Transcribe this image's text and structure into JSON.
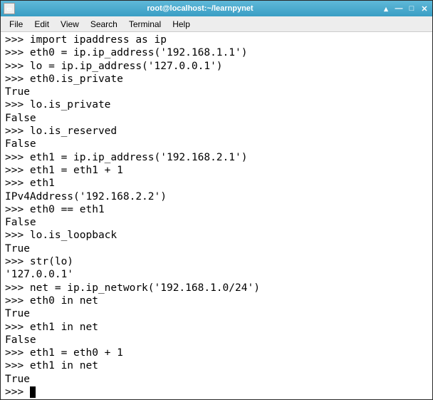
{
  "window": {
    "title": "root@localhost:~/learnpynet"
  },
  "titlebar_buttons": {
    "rollup": "▴",
    "minimize": "—",
    "maximize": "□",
    "close": "✕"
  },
  "menubar": {
    "items": [
      "File",
      "Edit",
      "View",
      "Search",
      "Terminal",
      "Help"
    ]
  },
  "terminal": {
    "lines": [
      ">>> import ipaddress as ip",
      ">>> eth0 = ip.ip_address('192.168.1.1')",
      ">>> lo = ip.ip_address('127.0.0.1')",
      ">>> eth0.is_private",
      "True",
      ">>> lo.is_private",
      "False",
      ">>> lo.is_reserved",
      "False",
      ">>> eth1 = ip.ip_address('192.168.2.1')",
      ">>> eth1 = eth1 + 1",
      ">>> eth1",
      "IPv4Address('192.168.2.2')",
      ">>> eth0 == eth1",
      "False",
      ">>> lo.is_loopback",
      "True",
      ">>> str(lo)",
      "'127.0.0.1'",
      ">>> net = ip.ip_network('192.168.1.0/24')",
      ">>> eth0 in net",
      "True",
      ">>> eth1 in net",
      "False",
      ">>> eth1 = eth0 + 1",
      ">>> eth1 in net",
      "True",
      ">>> "
    ]
  }
}
